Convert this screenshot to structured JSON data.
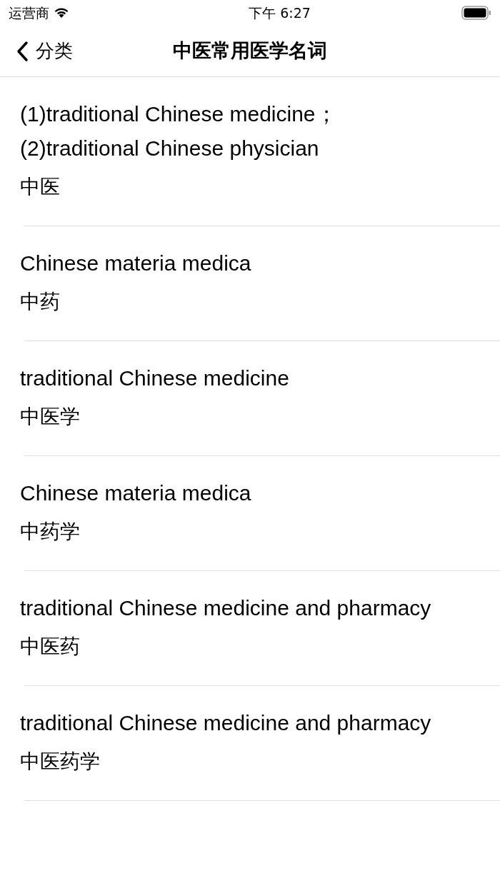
{
  "status_bar": {
    "carrier": "运营商",
    "time": "下午 6:27"
  },
  "nav_bar": {
    "back_label": "分类",
    "title": "中医常用医学名词"
  },
  "terms": [
    {
      "english": "(1)traditional Chinese medicine；\n(2)traditional Chinese physician",
      "chinese": "中医"
    },
    {
      "english": "Chinese materia medica",
      "chinese": "中药"
    },
    {
      "english": "traditional Chinese medicine",
      "chinese": "中医学"
    },
    {
      "english": "Chinese materia medica",
      "chinese": "中药学"
    },
    {
      "english": "traditional Chinese medicine and pharmacy",
      "chinese": "中医药"
    },
    {
      "english": "traditional Chinese medicine and pharmacy",
      "chinese": "中医药学"
    }
  ]
}
